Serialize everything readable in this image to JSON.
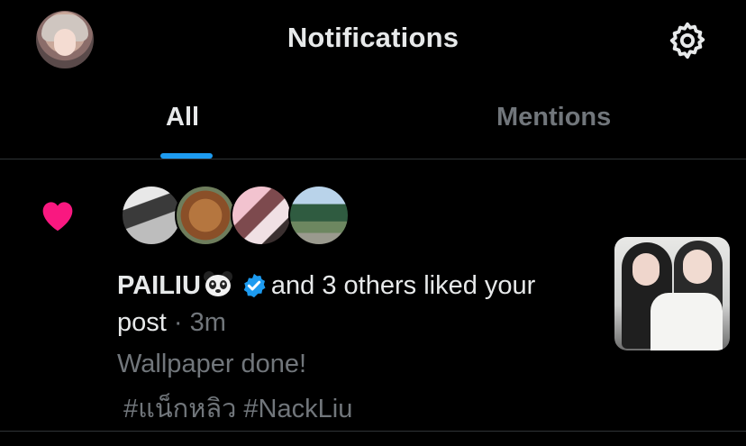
{
  "header": {
    "title": "Notifications",
    "avatar_icon": "user-avatar",
    "settings_icon": "gear-icon"
  },
  "tabs": [
    {
      "label": "All",
      "active": true
    },
    {
      "label": "Mentions",
      "active": false
    }
  ],
  "colors": {
    "background": "#000000",
    "accent": "#1d9bf0",
    "like": "#f91880",
    "text": "#e7e9ea",
    "muted": "#71767b"
  },
  "notification": {
    "type_icon": "heart-icon",
    "likers": [
      "liker-avatar-1",
      "liker-avatar-2",
      "liker-avatar-3",
      "liker-avatar-4"
    ],
    "username": "PAILIU",
    "username_emoji_icon": "panda-icon",
    "verified_icon": "verified-badge-icon",
    "action_text_1": "and 3 others liked your",
    "action_text_2": "post",
    "separator": " · ",
    "time": "3m",
    "post_text": "Wallpaper done!",
    "hashtags": "#แน็กหลิว #NackLiu",
    "thumbnail": "post-thumbnail"
  }
}
